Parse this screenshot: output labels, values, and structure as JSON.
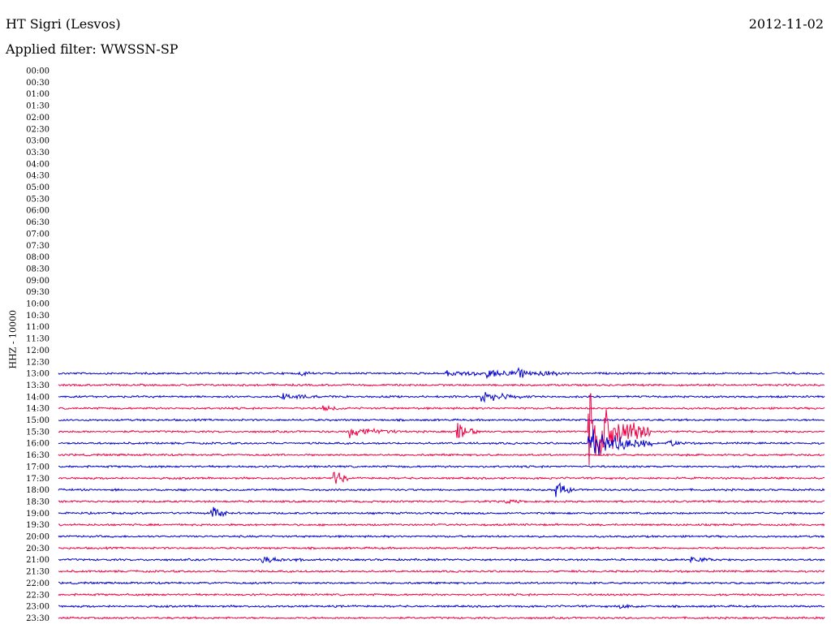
{
  "header": {
    "station": "HT Sigri (Lesvos)",
    "date": "2012-11-02",
    "filter_prefix": "Applied filter:",
    "filter_name": "WWSSN-SP"
  },
  "channel_label": "HHZ - 10000",
  "chart_data": {
    "type": "helicorder",
    "time_labels": [
      "00:00",
      "00:30",
      "01:00",
      "01:30",
      "02:00",
      "02:30",
      "03:00",
      "03:30",
      "04:00",
      "04:30",
      "05:00",
      "05:30",
      "06:00",
      "06:30",
      "07:00",
      "07:30",
      "08:00",
      "08:30",
      "09:00",
      "09:30",
      "10:00",
      "10:30",
      "11:00",
      "11:30",
      "12:00",
      "12:30",
      "13:00",
      "13:30",
      "14:00",
      "14:30",
      "15:00",
      "15:30",
      "16:00",
      "16:30",
      "17:00",
      "17:30",
      "18:00",
      "18:30",
      "19:00",
      "19:30",
      "20:00",
      "20:30",
      "21:00",
      "21:30",
      "22:00",
      "22:30",
      "23:00",
      "23:30"
    ],
    "first_trace_row": 26,
    "trace_colors": [
      "#0000cc",
      "#ee0044"
    ],
    "minutes_per_line": 30,
    "events": [
      {
        "row": 26,
        "minute": 9.5,
        "amp": 0.3,
        "dur": 0.4
      },
      {
        "row": 26,
        "minute": 15.2,
        "amp": 0.3,
        "dur": 3.0
      },
      {
        "row": 26,
        "minute": 16.8,
        "amp": 0.35,
        "dur": 2.0
      },
      {
        "row": 26,
        "minute": 18.0,
        "amp": 0.4,
        "dur": 0.6
      },
      {
        "row": 26,
        "minute": 18.8,
        "amp": 0.35,
        "dur": 1.2
      },
      {
        "row": 28,
        "minute": 8.8,
        "amp": 0.35,
        "dur": 1.5
      },
      {
        "row": 28,
        "minute": 16.6,
        "amp": 0.6,
        "dur": 1.6
      },
      {
        "row": 29,
        "minute": 10.4,
        "amp": 0.25,
        "dur": 0.8
      },
      {
        "row": 31,
        "minute": 11.4,
        "amp": 0.55,
        "dur": 2.0
      },
      {
        "row": 31,
        "minute": 15.6,
        "amp": 1.2,
        "dur": 0.8
      },
      {
        "row": 31,
        "minute": 20.8,
        "amp": 4.2,
        "dur": 2.4
      },
      {
        "row": 32,
        "minute": 20.8,
        "amp": 1.6,
        "dur": 2.5
      },
      {
        "row": 32,
        "minute": 23.8,
        "amp": 0.4,
        "dur": 0.8
      },
      {
        "row": 35,
        "minute": 10.8,
        "amp": 0.9,
        "dur": 0.6
      },
      {
        "row": 36,
        "minute": 19.5,
        "amp": 0.8,
        "dur": 0.7
      },
      {
        "row": 37,
        "minute": 17.5,
        "amp": 0.3,
        "dur": 0.6
      },
      {
        "row": 38,
        "minute": 6.0,
        "amp": 0.8,
        "dur": 0.6
      },
      {
        "row": 42,
        "minute": 8.0,
        "amp": 0.3,
        "dur": 1.8
      },
      {
        "row": 42,
        "minute": 24.8,
        "amp": 0.3,
        "dur": 1.0
      },
      {
        "row": 46,
        "minute": 22.0,
        "amp": 0.2,
        "dur": 0.8
      }
    ]
  }
}
